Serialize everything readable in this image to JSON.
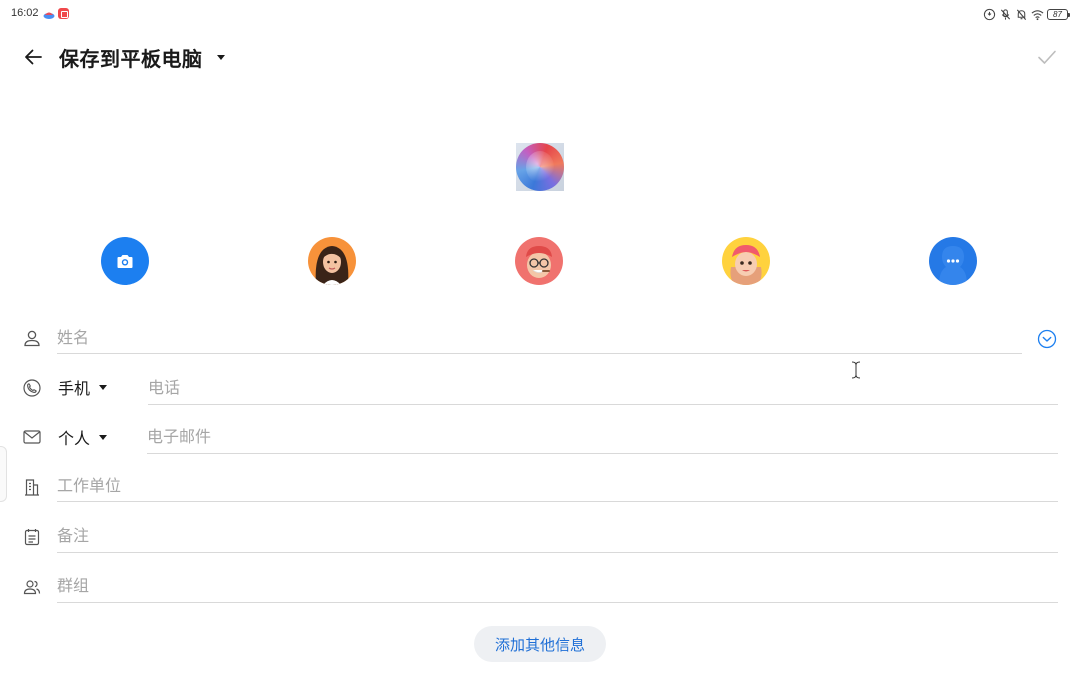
{
  "status_bar": {
    "time": "16:02",
    "battery": "87",
    "icons": [
      "screen-record-icon",
      "mic-off-icon",
      "bell-off-icon",
      "wifi-icon",
      "battery-icon"
    ]
  },
  "header": {
    "back_icon": "arrow-left-icon",
    "title": "保存到平板电脑",
    "confirm_icon": "checkmark-icon"
  },
  "photo": {
    "icon": "contact-photo"
  },
  "avatars": [
    "camera-icon",
    "avatar-girl",
    "avatar-glasses-man",
    "avatar-cap-girl",
    "more-icon"
  ],
  "form": {
    "name": {
      "placeholder": "姓名",
      "icon": "person-icon"
    },
    "phone": {
      "type": "手机",
      "placeholder": "电话",
      "icon": "phone-icon"
    },
    "email": {
      "type": "个人",
      "placeholder": "电子邮件",
      "icon": "mail-icon"
    },
    "company": {
      "placeholder": "工作单位",
      "icon": "building-icon"
    },
    "note": {
      "placeholder": "备注",
      "icon": "note-icon"
    },
    "group": {
      "placeholder": "群组",
      "icon": "group-icon"
    }
  },
  "add_more_label": "添加其他信息",
  "colors": {
    "accent": "#1c7ff0",
    "link": "#1f6fd6",
    "divider": "#d9d9d9",
    "placeholder": "#a6a6a6"
  }
}
